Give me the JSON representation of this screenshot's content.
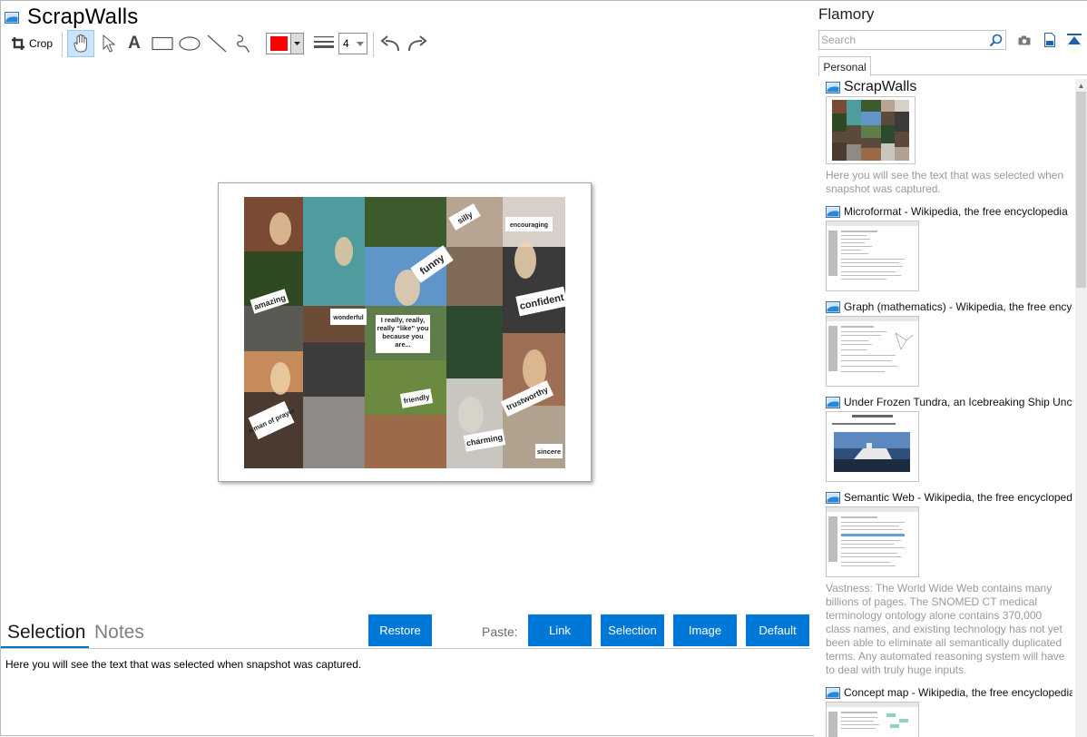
{
  "window": {
    "title": "ScrapWalls"
  },
  "toolbar": {
    "crop_label": "Crop",
    "text_tool_glyph": "A",
    "color_value": "#ff0000",
    "line_width": "4"
  },
  "collage_words": [
    "silly",
    "encouraging",
    "funny",
    "confident",
    "amazing",
    "wonderful",
    "I really, really, really “like” you because you are...",
    "friendly",
    "trustworthy",
    "a man of prayer",
    "charming",
    "sincere"
  ],
  "bottom": {
    "tab_selection": "Selection",
    "tab_notes": "Notes",
    "restore_label": "Restore",
    "paste_label": "Paste:",
    "link_label": "Link",
    "selection_label": "Selection",
    "image_label": "Image",
    "default_label": "Default",
    "selection_text": "Here you will see the text that was selected when snapshot was captured."
  },
  "panel": {
    "title": "Flamory",
    "search_placeholder": "Search",
    "tab_personal": "Personal",
    "items": [
      {
        "title": "ScrapWalls",
        "desc": "Here you will see the text that was selected when snapshot was captured."
      },
      {
        "title": "Microformat - Wikipedia, the free encyclopedia"
      },
      {
        "title": "Graph (mathematics) - Wikipedia, the free ency"
      },
      {
        "title": "Under Frozen Tundra, an Icebreaking Ship Unco"
      },
      {
        "title": "Semantic Web - Wikipedia, the free encycloped",
        "desc": "Vastness: The World Wide Web contains many billions of pages. The SNOMED CT medical terminology ontology alone contains 370,000 class names, and existing technology has not yet been able to eliminate all semantically duplicated terms. Any automated reasoning system will have to deal with truly huge inputs."
      },
      {
        "title": "Concept map - Wikipedia, the free encyclopedia"
      }
    ]
  },
  "colors": {
    "accent": "#0078d7",
    "tab_underline": "#0072c6",
    "muted_text": "#9a9a9a"
  }
}
